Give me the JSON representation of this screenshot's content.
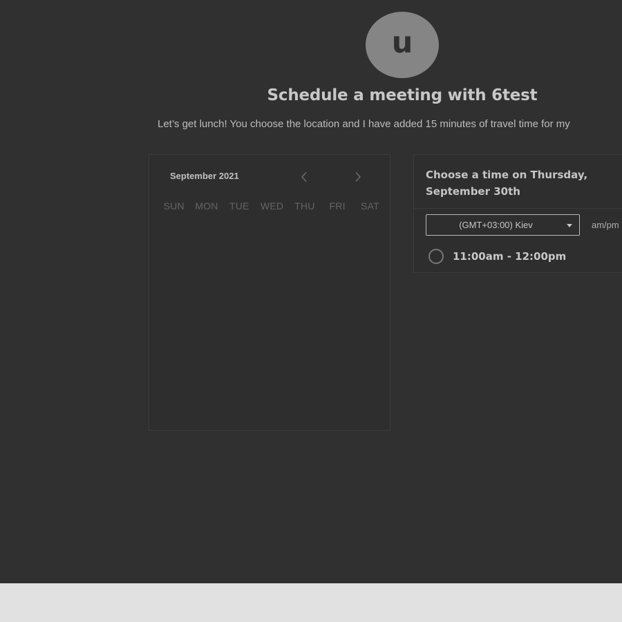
{
  "profile": {
    "avatar_initial": "u",
    "title": "Schedule a meeting with 6test",
    "description": "Let’s get lunch! You choose the location and I have added 15 minutes of travel time for my"
  },
  "calendar": {
    "month_label": "September 2021",
    "prev_icon": "chevron-left-icon",
    "next_icon": "chevron-right-icon",
    "weekdays": [
      "SUN",
      "MON",
      "TUE",
      "WED",
      "THU",
      "FRI",
      "SAT"
    ]
  },
  "time_panel": {
    "heading": "Choose a time on Thursday, September 30th",
    "timezone": "(GMT+03:00) Kiev",
    "format_toggle": "am/pm",
    "slots": [
      {
        "label": "11:00am - 12:00pm"
      }
    ]
  },
  "colors": {
    "background": "#303030",
    "footer": "#e1e1e1",
    "avatar": "#858585"
  }
}
